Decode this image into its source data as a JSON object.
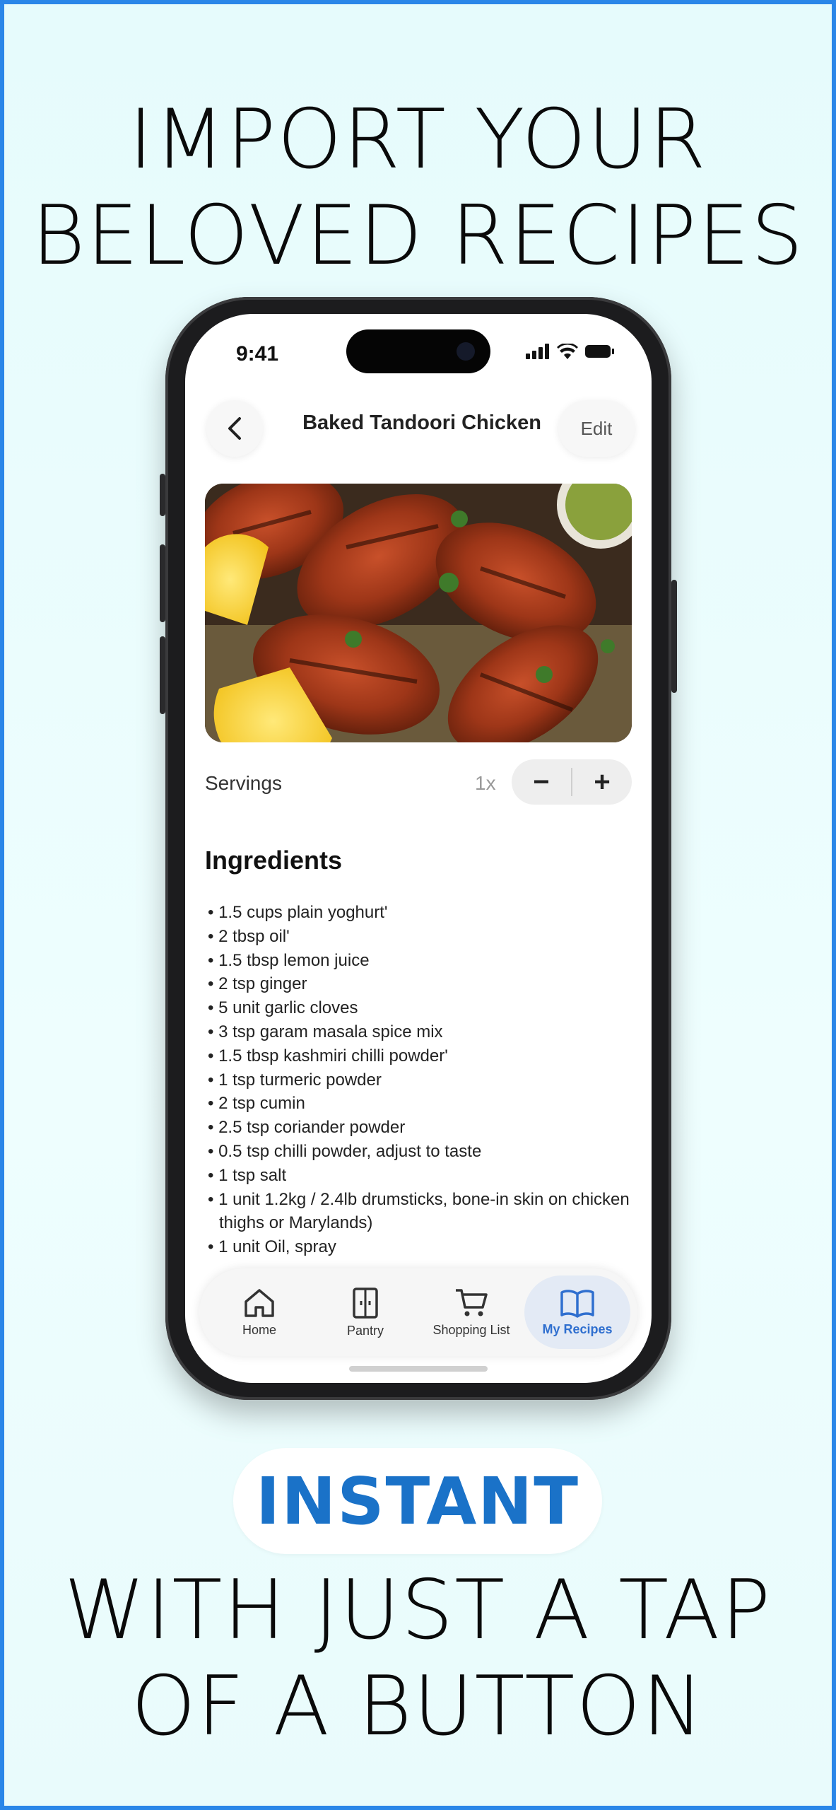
{
  "headline_top": [
    "IMPORT YOUR",
    "BELOVED RECIPES"
  ],
  "badge": "INSTANT",
  "headline_bottom": [
    "WITH JUST A TAP",
    "OF A BUTTON"
  ],
  "colors": {
    "accent": "#1a72c8",
    "border": "#2a86e8",
    "background": "#eafdfd",
    "tab_active": "#2f6fcf"
  },
  "phone": {
    "status_time": "9:41",
    "nav": {
      "back_icon": "chevron-left-icon",
      "title": "Baked Tandoori Chicken",
      "edit_label": "Edit"
    },
    "servings": {
      "label": "Servings",
      "multiplier": "1x",
      "minus": "−",
      "plus": "+"
    },
    "ingredients_title": "Ingredients",
    "ingredients": [
      "1.5 cups plain yoghurt'",
      "2 tbsp oil'",
      "1.5 tbsp lemon juice",
      "2 tsp ginger",
      "5 unit garlic cloves",
      "3 tsp garam masala spice mix",
      "1.5 tbsp kashmiri chilli powder'",
      "1 tsp turmeric powder",
      "2 tsp cumin",
      "2.5 tsp coriander powder",
      "0.5 tsp chilli powder, adjust to taste",
      "1 tsp salt",
      "1 unit 1.2kg / 2.4lb drumsticks, bone-in skin on chicken thighs or Marylands)",
      "1 unit Oil, spray"
    ],
    "tabs": [
      {
        "label": "Home",
        "icon": "home-icon"
      },
      {
        "label": "Pantry",
        "icon": "pantry-icon"
      },
      {
        "label": "Shopping List",
        "icon": "cart-icon"
      },
      {
        "label": "My Recipes",
        "icon": "book-icon",
        "active": true
      }
    ]
  }
}
